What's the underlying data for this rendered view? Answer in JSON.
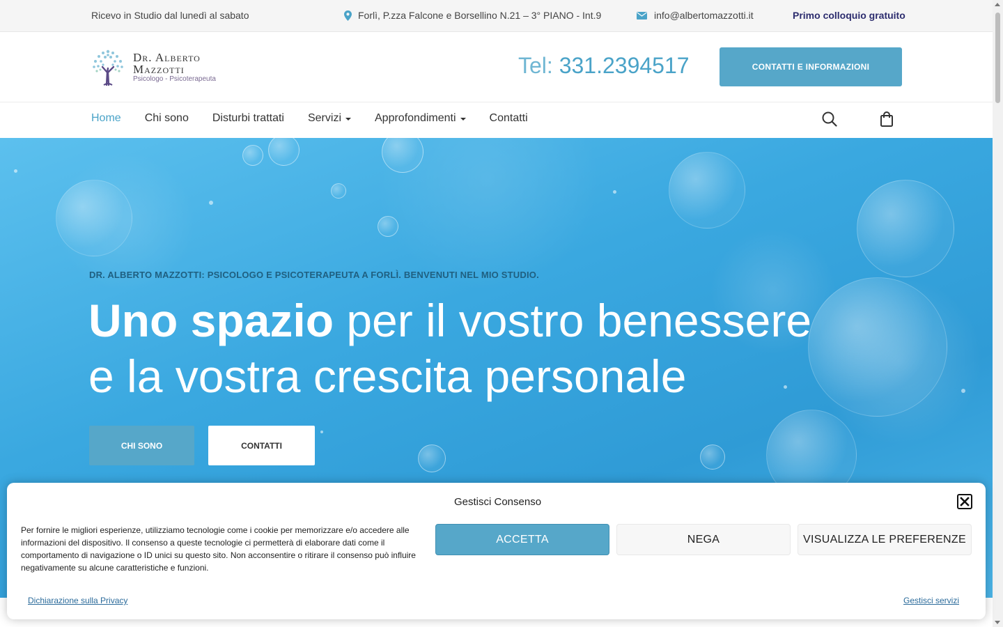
{
  "colors": {
    "accent": "#56a7c9",
    "phone": "#4aa3c8",
    "top_bar_bg": "#f5f5f5",
    "brand_dark": "#2c2c6e"
  },
  "topbar": {
    "hours": "Ricevo in Studio dal lunedì al sabato",
    "address": "Forlì, P.zza Falcone e Borsellino N.21 – 3° PIANO - Int.9",
    "email": "info@albertomazzotti.it",
    "free_consult": "Primo colloquio gratuito"
  },
  "header": {
    "logo_line1": "Dr. Alberto",
    "logo_line2": "Mazzotti",
    "logo_sub": "Psicologo - Psicoterapeuta",
    "phone_label": "Tel:",
    "phone_number": "331.2394517",
    "cta_label": "CONTATTI E INFORMAZIONI"
  },
  "nav": {
    "items": [
      {
        "label": "Home",
        "active": true,
        "dropdown": false
      },
      {
        "label": "Chi sono",
        "active": false,
        "dropdown": false
      },
      {
        "label": "Disturbi trattati",
        "active": false,
        "dropdown": false
      },
      {
        "label": "Servizi",
        "active": false,
        "dropdown": true
      },
      {
        "label": "Approfondimenti",
        "active": false,
        "dropdown": true
      },
      {
        "label": "Contatti",
        "active": false,
        "dropdown": false
      }
    ],
    "icons": [
      "search-icon",
      "shopping-bag-icon"
    ]
  },
  "hero": {
    "kicker": "DR. ALBERTO MAZZOTTI: PSICOLOGO E PSICOTERAPEUTA A FORLÌ. BENVENUTI NEL MIO STUDIO.",
    "headline_bold": "Uno spazio",
    "headline_rest1": " per il vostro benessere",
    "headline_rest2": "e la vostra crescita personale",
    "btn_primary": "CHI SONO",
    "btn_secondary": "CONTATTI"
  },
  "consent": {
    "title": "Gestisci Consenso",
    "text": "Per fornire le migliori esperienze, utilizziamo tecnologie come i cookie per memorizzare e/o accedere alle informazioni del dispositivo. Il consenso a queste tecnologie ci permetterà di elaborare dati come il comportamento di navigazione o ID unici su questo sito. Non acconsentire o ritirare il consenso può influire negativamente su alcune caratteristiche e funzioni.",
    "accept": "ACCETTA",
    "deny": "NEGA",
    "preferences": "VISUALIZZA LE PREFERENZE",
    "privacy_link": "Dichiarazione sulla Privacy",
    "services_link": "Gestisci servizi"
  }
}
